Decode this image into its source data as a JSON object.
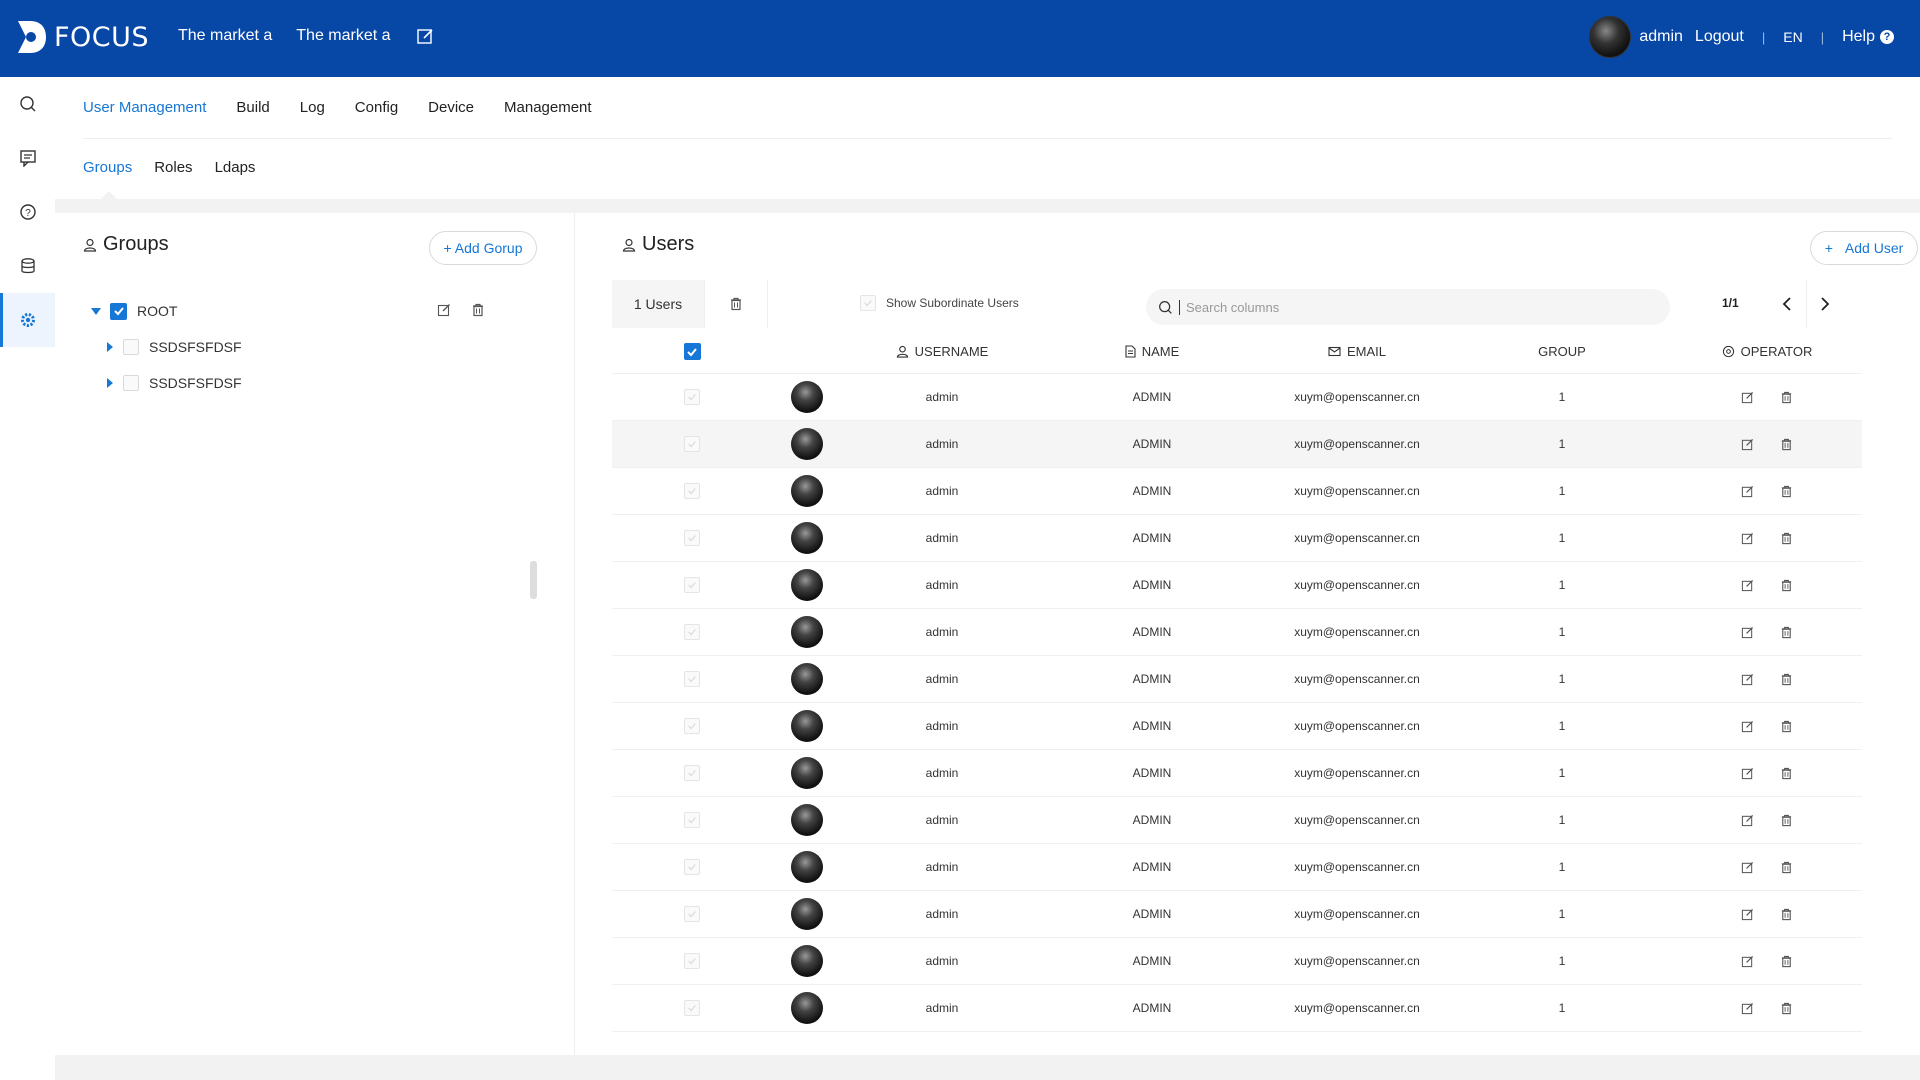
{
  "app": {
    "name": "FOCUS"
  },
  "topnav": {
    "items": [
      "The market a",
      "The market a"
    ]
  },
  "topright": {
    "user": "admin",
    "logout": "Logout",
    "lang": "EN",
    "help": "Help",
    "sep": "|"
  },
  "rail": {
    "icons": [
      "search-icon",
      "chat-board-icon",
      "help-circle-icon",
      "database-icon",
      "settings-icon"
    ],
    "active_index": 4
  },
  "tabs": {
    "main": [
      "User Management",
      "Build",
      "Log",
      "Config",
      "Device",
      "Management"
    ],
    "main_active": 0,
    "sub": [
      "Groups",
      "Roles",
      "Ldaps"
    ],
    "sub_active": 0
  },
  "groups": {
    "title": "Groups",
    "add_label": "+ Add Gorup",
    "tree": [
      {
        "label": "ROOT",
        "checked": true,
        "expanded": true
      },
      {
        "label": "SSDSFSFDSF",
        "checked": false
      },
      {
        "label": "SSDSFSFDSF",
        "checked": false
      }
    ]
  },
  "users": {
    "title": "Users",
    "add_label": "Add User",
    "count": "1 Users",
    "show_subordinate": "Show Subordinate Users",
    "search_placeholder": "Search columns",
    "pager": "1/1",
    "columns": {
      "username": "USERNAME",
      "name": "NAME",
      "email": "EMAIL",
      "group": "GROUP",
      "operator": "OPERATOR"
    },
    "rows": [
      {
        "username": "admin",
        "name": "ADMIN",
        "email": "xuym@openscanner.cn",
        "group": "1"
      },
      {
        "username": "admin",
        "name": "ADMIN",
        "email": "xuym@openscanner.cn",
        "group": "1"
      },
      {
        "username": "admin",
        "name": "ADMIN",
        "email": "xuym@openscanner.cn",
        "group": "1"
      },
      {
        "username": "admin",
        "name": "ADMIN",
        "email": "xuym@openscanner.cn",
        "group": "1"
      },
      {
        "username": "admin",
        "name": "ADMIN",
        "email": "xuym@openscanner.cn",
        "group": "1"
      },
      {
        "username": "admin",
        "name": "ADMIN",
        "email": "xuym@openscanner.cn",
        "group": "1"
      },
      {
        "username": "admin",
        "name": "ADMIN",
        "email": "xuym@openscanner.cn",
        "group": "1"
      },
      {
        "username": "admin",
        "name": "ADMIN",
        "email": "xuym@openscanner.cn",
        "group": "1"
      },
      {
        "username": "admin",
        "name": "ADMIN",
        "email": "xuym@openscanner.cn",
        "group": "1"
      },
      {
        "username": "admin",
        "name": "ADMIN",
        "email": "xuym@openscanner.cn",
        "group": "1"
      },
      {
        "username": "admin",
        "name": "ADMIN",
        "email": "xuym@openscanner.cn",
        "group": "1"
      },
      {
        "username": "admin",
        "name": "ADMIN",
        "email": "xuym@openscanner.cn",
        "group": "1"
      },
      {
        "username": "admin",
        "name": "ADMIN",
        "email": "xuym@openscanner.cn",
        "group": "1"
      },
      {
        "username": "admin",
        "name": "ADMIN",
        "email": "xuym@openscanner.cn",
        "group": "1"
      }
    ],
    "highlighted_row": 1
  },
  "colors": {
    "brand": "#0747a6",
    "accent": "#1677d6"
  }
}
